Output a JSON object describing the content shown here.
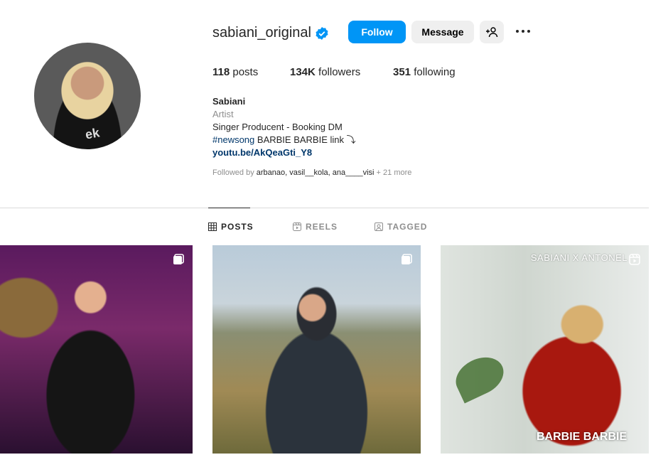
{
  "profile": {
    "username": "sabiani_original",
    "verified": true,
    "avatar_shirt_text": "ek"
  },
  "actions": {
    "follow_label": "Follow",
    "message_label": "Message",
    "add_user_icon": "add-user-icon",
    "more_icon": "more-options-icon"
  },
  "stats": {
    "posts_count": "118",
    "posts_label": "posts",
    "followers_count": "134K",
    "followers_label": "followers",
    "following_count": "351",
    "following_label": "following"
  },
  "bio": {
    "name": "Sabiani",
    "category": "Artist",
    "line1": "Singer Producent - Booking DM",
    "hashtag": "#newsong",
    "line2_rest": " BARBIE BARBIE link ⤵",
    "link": "youtu.be/AkQeaGti_Y8"
  },
  "followed_by": {
    "prefix": "Followed by ",
    "accounts": "arbanao, vasil__kola, ana____visi",
    "suffix": " + 21 more"
  },
  "tabs": [
    {
      "label": "POSTS",
      "active": true,
      "icon": "grid-icon"
    },
    {
      "label": "REELS",
      "active": false,
      "icon": "reels-icon"
    },
    {
      "label": "TAGGED",
      "active": false,
      "icon": "tagged-icon"
    }
  ],
  "posts": [
    {
      "type": "image",
      "badge": "carousel-icon"
    },
    {
      "type": "image",
      "badge": "carousel-icon"
    },
    {
      "type": "reel",
      "badge": "reels-icon",
      "overlay_title": "SABIANI X ANTONEL",
      "caption": "BARBIE BARBIE"
    }
  ],
  "colors": {
    "accent": "#0095f6",
    "secondary_button": "#efefef",
    "muted_text": "#8e8e8e",
    "link": "#00376b",
    "divider": "#dbdbdb"
  }
}
